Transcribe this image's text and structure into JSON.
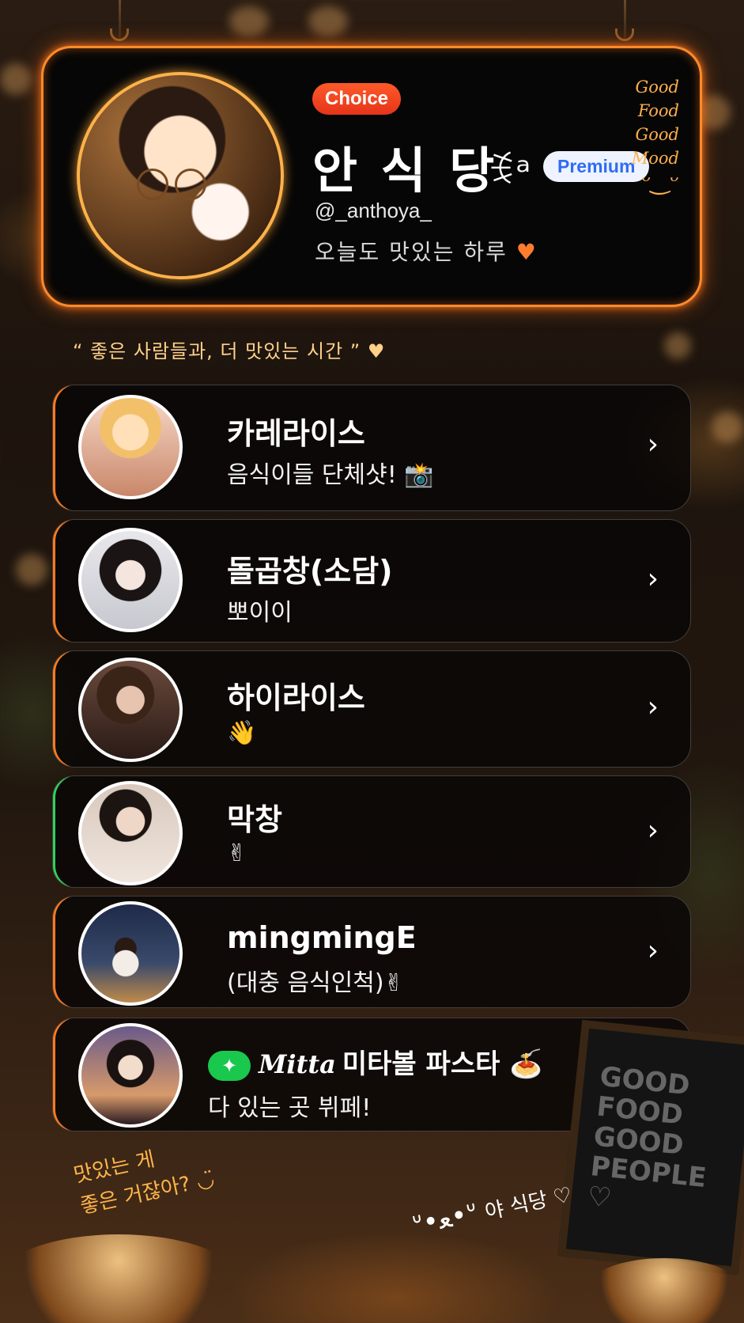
{
  "profile": {
    "badge": "Choice",
    "name": "안 식 당",
    "name_icon": "ꉂᵃ",
    "premium": "Premium",
    "handle": "@_anthoya_",
    "motto": "오늘도 맛있는 하루",
    "motto_heart": "♥",
    "mood_lines": [
      "Good",
      "Food",
      "Good",
      "Mood"
    ],
    "mood_smile": "ᵕ‿ᵕ"
  },
  "quote": "“ 좋은 사람들과, 더 맛있는 시간 ” ♥",
  "links": [
    {
      "title": "카레라이스",
      "subtitle": "음식이들 단체샷! 📸"
    },
    {
      "title": "돌곱창(소담)",
      "subtitle": "뽀이이"
    },
    {
      "title": "하이라이스",
      "subtitle": "👋"
    },
    {
      "title": "막창",
      "subtitle": "✌"
    },
    {
      "title": "mingmingE",
      "subtitle": "(대충 음식인척)✌"
    },
    {
      "title_prefix": "✦",
      "title_brand": "Mitta",
      "title": "미타볼 파스타 🍝",
      "subtitle": "다 있는 곳 뷔페!"
    }
  ],
  "chevron": "›",
  "footer": {
    "left_note_1": "맛있는 게",
    "left_note_2": "좋은 거잖아? ◡̈",
    "right_note": "야 식당 ♡",
    "chalkboard": [
      "GOOD",
      "FOOD",
      "GOOD",
      "PEOPLE",
      "♡"
    ]
  },
  "colors": {
    "accent": "#ff7a1f",
    "premium": "#2f6df0",
    "green": "#19c84d"
  }
}
